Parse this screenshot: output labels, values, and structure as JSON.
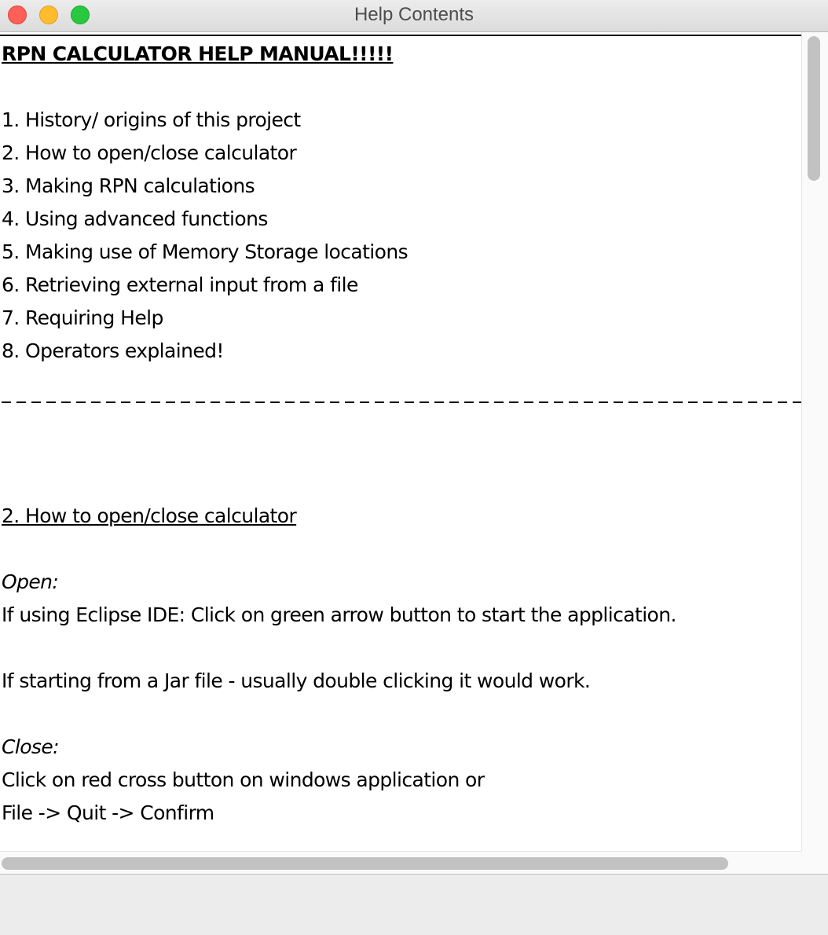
{
  "window": {
    "title": "Help Contents"
  },
  "document": {
    "heading": "RPN CALCULATOR HELP MANUAL!!!!!",
    "toc": [
      "1. History/ origins of this project",
      "2. How to open/close calculator",
      "3. Making RPN calculations",
      "4. Using advanced functions",
      "5. Making use of Memory Storage locations",
      "6. Retrieving external input from a file",
      "7. Requiring Help",
      "8. Operators explained!"
    ],
    "section2": {
      "heading": "2. How to open/close calculator",
      "open_label": "Open:",
      "open_line1": "If using Eclipse IDE: Click on green arrow button to start the application.",
      "open_line2": "If starting from a Jar file - usually double clicking it would work.",
      "close_label": "Close:",
      "close_line1": "Click on red cross button on windows application or",
      "close_line2": "File -> Quit -> Confirm"
    }
  }
}
